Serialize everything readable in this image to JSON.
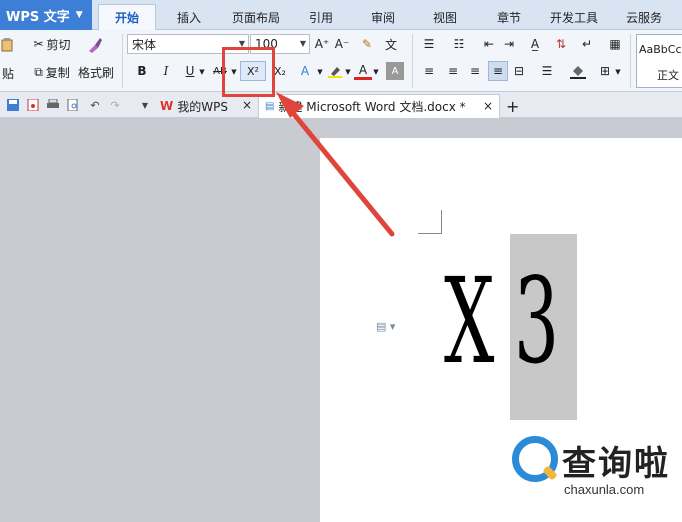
{
  "app": {
    "title": "WPS 文字"
  },
  "menu": {
    "tabs": [
      {
        "label": "开始",
        "active": true
      },
      {
        "label": "插入"
      },
      {
        "label": "页面布局"
      },
      {
        "label": "引用"
      },
      {
        "label": "审阅"
      },
      {
        "label": "视图"
      },
      {
        "label": "章节"
      },
      {
        "label": "开发工具"
      },
      {
        "label": "云服务"
      }
    ]
  },
  "ribbon": {
    "paste_label": "贴",
    "cut_label": "剪切",
    "copy_label": "复制",
    "format_painter_label": "格式刷",
    "font_name": "宋体",
    "font_size": "100",
    "bold": "B",
    "italic": "I",
    "underline": "U",
    "strike": "AB",
    "superscript": "X²",
    "subscript": "X₂",
    "style_preview": "AaBbCc",
    "style_name": "正文"
  },
  "quickbar": {
    "tabs": [
      {
        "label": "我的WPS",
        "close": "×"
      },
      {
        "label": "新建 Microsoft Word 文档.docx *",
        "close": "×"
      }
    ],
    "add_tab": "+"
  },
  "document": {
    "text_plain": "X",
    "text_selected": "3"
  },
  "watermark": {
    "title": "查询啦",
    "subtitle": "chaxunla.com"
  },
  "colors": {
    "accent": "#3d7fd6",
    "highlight_red": "#e0453c"
  }
}
